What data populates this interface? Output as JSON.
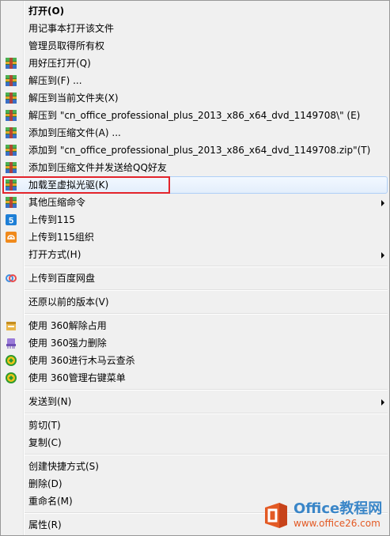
{
  "menu": {
    "items": [
      {
        "type": "item",
        "label": "打开(O)",
        "bold": true,
        "icon": "",
        "submenu": false
      },
      {
        "type": "item",
        "label": "用记事本打开该文件",
        "icon": "",
        "submenu": false
      },
      {
        "type": "item",
        "label": "管理员取得所有权",
        "icon": "",
        "submenu": false
      },
      {
        "type": "item",
        "label": "用好压打开(Q)",
        "icon": "haozip-icon",
        "submenu": false
      },
      {
        "type": "item",
        "label": "解压到(F) ...",
        "icon": "haozip-icon",
        "submenu": false
      },
      {
        "type": "item",
        "label": "解压到当前文件夹(X)",
        "icon": "haozip-icon",
        "submenu": false
      },
      {
        "type": "item",
        "label": "解压到 \"cn_office_professional_plus_2013_x86_x64_dvd_1149708\\\" (E)",
        "icon": "haozip-icon",
        "submenu": false
      },
      {
        "type": "item",
        "label": "添加到压缩文件(A) ...",
        "icon": "haozip-icon",
        "submenu": false
      },
      {
        "type": "item",
        "label": "添加到 \"cn_office_professional_plus_2013_x86_x64_dvd_1149708.zip\"(T)",
        "icon": "haozip-icon",
        "submenu": false
      },
      {
        "type": "item",
        "label": "添加到压缩文件并发送给QQ好友",
        "icon": "haozip-icon",
        "submenu": false
      },
      {
        "type": "item",
        "label": "加载至虚拟光驱(K)",
        "icon": "haozip-icon",
        "submenu": false,
        "hover": true
      },
      {
        "type": "item",
        "label": "其他压缩命令",
        "icon": "haozip-icon",
        "submenu": true
      },
      {
        "type": "item",
        "label": "上传到115",
        "icon": "115-icon",
        "submenu": false
      },
      {
        "type": "item",
        "label": "上传到115组织",
        "icon": "115-org-icon",
        "submenu": false
      },
      {
        "type": "item",
        "label": "打开方式(H)",
        "icon": "",
        "submenu": true
      },
      {
        "type": "sep"
      },
      {
        "type": "item",
        "label": "上传到百度网盘",
        "icon": "baidu-netdisk-icon",
        "submenu": false
      },
      {
        "type": "sep"
      },
      {
        "type": "item",
        "label": "还原以前的版本(V)",
        "icon": "",
        "submenu": false
      },
      {
        "type": "sep"
      },
      {
        "type": "item",
        "label": "使用 360解除占用",
        "icon": "360-unlock-icon",
        "submenu": false
      },
      {
        "type": "item",
        "label": "使用 360强力删除",
        "icon": "360-shred-icon",
        "submenu": false
      },
      {
        "type": "item",
        "label": "使用 360进行木马云查杀",
        "icon": "360-scan-icon",
        "submenu": false
      },
      {
        "type": "item",
        "label": "使用 360管理右键菜单",
        "icon": "360-menu-icon",
        "submenu": false
      },
      {
        "type": "sep"
      },
      {
        "type": "item",
        "label": "发送到(N)",
        "icon": "",
        "submenu": true
      },
      {
        "type": "sep"
      },
      {
        "type": "item",
        "label": "剪切(T)",
        "icon": "",
        "submenu": false
      },
      {
        "type": "item",
        "label": "复制(C)",
        "icon": "",
        "submenu": false
      },
      {
        "type": "sep"
      },
      {
        "type": "item",
        "label": "创建快捷方式(S)",
        "icon": "",
        "submenu": false
      },
      {
        "type": "item",
        "label": "删除(D)",
        "icon": "",
        "submenu": false
      },
      {
        "type": "item",
        "label": "重命名(M)",
        "icon": "",
        "submenu": false
      },
      {
        "type": "sep"
      },
      {
        "type": "item",
        "label": "属性(R)",
        "icon": "",
        "submenu": false
      }
    ]
  },
  "watermark": {
    "brand": "Office教程网",
    "url": "www.office26.com",
    "icon": "office-logo-icon"
  },
  "colors": {
    "menu_bg": "#f0f0f0",
    "highlight_border": "#e3242b",
    "hover_border": "#aecff7"
  }
}
